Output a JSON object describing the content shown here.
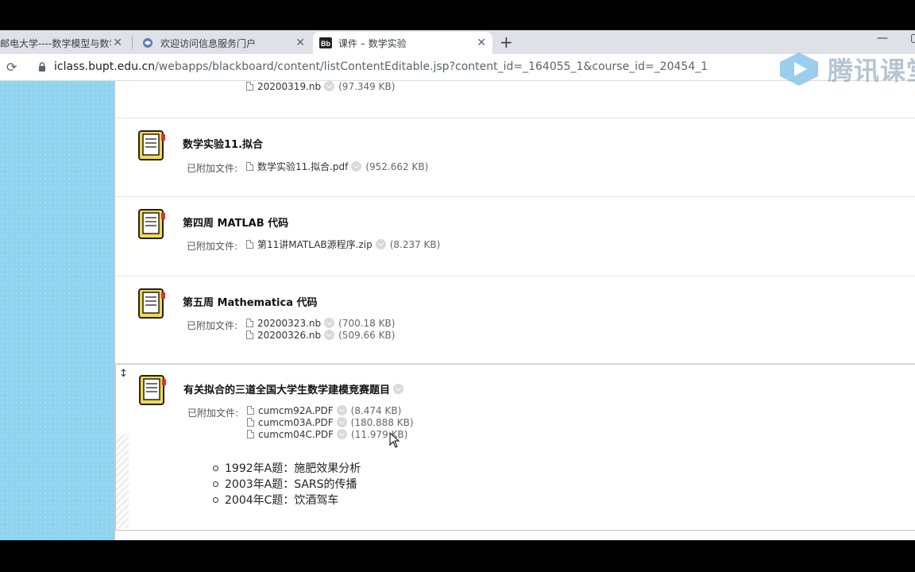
{
  "browser": {
    "tabs": [
      {
        "title": "邮电大学----数学模型与数学",
        "active": false
      },
      {
        "title": "欢迎访问信息服务门户",
        "active": false
      },
      {
        "title": "课件 – 数学实验",
        "active": true
      }
    ],
    "new_tab_glyph": "+",
    "url_host": "iclass.bupt.edu.cn",
    "url_path": "/webapps/blackboard/content/listContentEditable.jsp?content_id=_164055_1&course_id=_20454_1"
  },
  "watermark": {
    "text": "腾讯课堂"
  },
  "content": {
    "top_partial_file": {
      "name": "20200319.nb",
      "size": "(97.349 KB)"
    },
    "items": [
      {
        "title": "数学实验11.拟合",
        "attached_label": "已附加文件:",
        "files": [
          {
            "name": "数学实验11.拟合.pdf",
            "size": "(952.662 KB)"
          }
        ]
      },
      {
        "title": "第四周 MATLAB 代码",
        "attached_label": "已附加文件:",
        "files": [
          {
            "name": "第11讲MATLAB源程序.zip",
            "size": "(8.237 KB)"
          }
        ]
      },
      {
        "title": "第五周 Mathematica 代码",
        "attached_label": "已附加文件:",
        "files": [
          {
            "name": "20200323.nb",
            "size": "(700.18 KB)"
          },
          {
            "name": "20200326.nb",
            "size": "(509.66 KB)"
          }
        ]
      },
      {
        "title": "有关拟合的三道全国大学生数学建模竞赛题目",
        "attached_label": "已附加文件:",
        "files": [
          {
            "name": "cumcm92A.PDF",
            "size": "(8.474 KB)"
          },
          {
            "name": "cumcm03A.PDF",
            "size": "(180.888 KB)"
          },
          {
            "name": "cumcm04C.PDF",
            "size": "(11.979 KB)"
          }
        ],
        "bullets": [
          "1992年A题：施肥效果分析",
          "2003年A题：SARS的传播",
          "2004年C题：饮酒驾车"
        ]
      }
    ]
  }
}
